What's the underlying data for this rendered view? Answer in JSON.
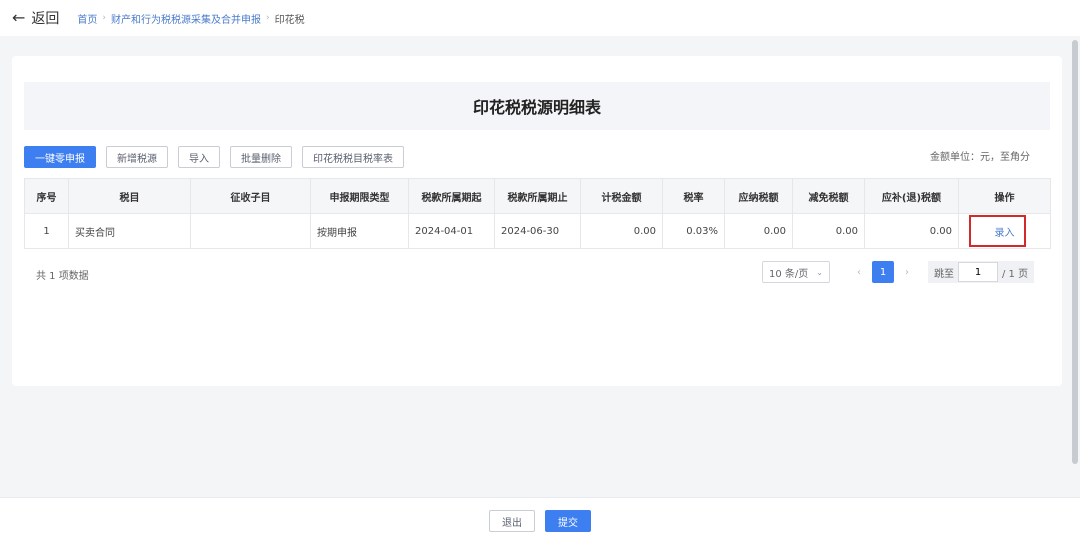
{
  "header": {
    "back_label": "返回",
    "breadcrumb": [
      "首页",
      "财产和行为税税源采集及合并申报",
      "印花税"
    ]
  },
  "page": {
    "title": "印花税税源明细表",
    "unit_note": "金额单位：元，至角分"
  },
  "toolbar": {
    "buttons": [
      "一键零申报",
      "新增税源",
      "导入",
      "批量删除",
      "印花税税目税率表"
    ]
  },
  "table": {
    "columns": [
      "序号",
      "税目",
      "征收子目",
      "申报期限类型",
      "税款所属期起",
      "税款所属期止",
      "计税金额",
      "税率",
      "应纳税额",
      "减免税额",
      "应补(退)税额",
      "操作"
    ],
    "rows": [
      {
        "index": "1",
        "item": "买卖合同",
        "sub_item": "",
        "period_type": "按期申报",
        "period_start": "2024-04-01",
        "period_end": "2024-06-30",
        "taxable_amount": "0.00",
        "rate": "0.03%",
        "tax_payable": "0.00",
        "tax_reduction": "0.00",
        "tax_due": "0.00",
        "action": "录入"
      }
    ]
  },
  "pagination": {
    "total_text": "共 1 项数据",
    "page_size": "10 条/页",
    "current_page": "1",
    "jump_label": "跳至",
    "jump_value": "1",
    "total_pages": "/ 1 页"
  },
  "footer": {
    "exit_label": "退出",
    "submit_label": "提交"
  },
  "colors": {
    "primary": "#3d7ef0",
    "highlight": "#d02a2a"
  }
}
